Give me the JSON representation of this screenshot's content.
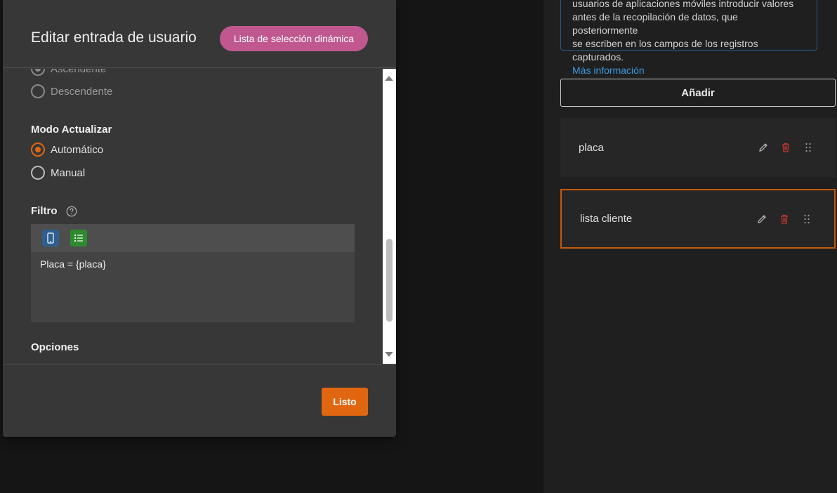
{
  "dialog": {
    "title": "Editar entrada de usuario",
    "type_badge": "Lista de selección dinámica"
  },
  "sort_order": {
    "options": [
      {
        "label": "Ascendente",
        "selected": true
      },
      {
        "label": "Descendente",
        "selected": false
      }
    ]
  },
  "refresh_mode": {
    "label": "Modo Actualizar",
    "options": [
      {
        "label": "Automático",
        "selected": true
      },
      {
        "label": "Manual",
        "selected": false
      }
    ]
  },
  "filter": {
    "label": "Filtro",
    "expression": "Placa = {placa}",
    "tools": [
      "mobile-device-icon",
      "list-icon"
    ]
  },
  "options_section": {
    "label": "Opciones"
  },
  "footer": {
    "done_label": "Listo"
  },
  "info": {
    "lines": [
      "usuarios de aplicaciones móviles introducir valores",
      "antes de la recopilación de datos, que posteriormente",
      "se escriben en los campos de los registros capturados."
    ],
    "link": "Más información"
  },
  "add_label": "Añadir",
  "fields": [
    {
      "name": "placa",
      "selected": false
    },
    {
      "name": "lista cliente",
      "selected": true
    }
  ],
  "colors": {
    "accent": "#e06610",
    "badge": "#c0588f",
    "delete": "#c03535",
    "link": "#3b9ae0"
  }
}
